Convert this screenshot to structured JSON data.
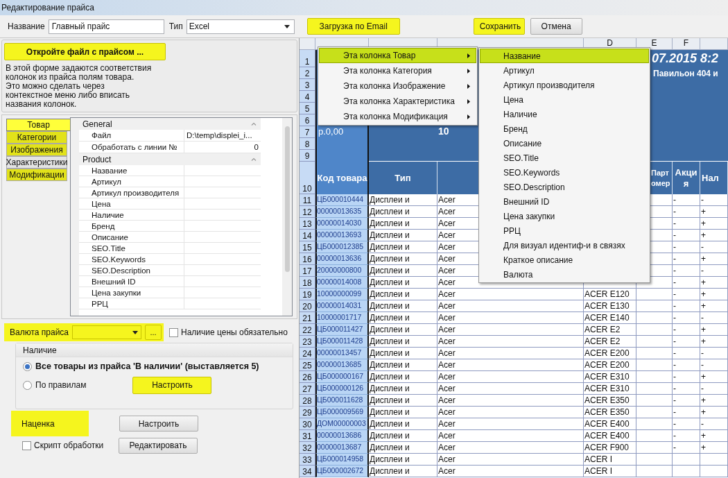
{
  "window": {
    "title": "Редактирование прайса"
  },
  "toolbar": {
    "name_label": "Название",
    "name_value": "Главный прайс",
    "type_label": "Тип",
    "type_value": "Excel",
    "buttons": [
      {
        "label": "Загрузка по Email",
        "highlighted": true
      },
      {
        "label": "Сохранить",
        "highlighted": true
      },
      {
        "label": "Отмена",
        "highlighted": false
      }
    ]
  },
  "open_file_button": {
    "label": "Откройте файл с прайсом ...",
    "highlighted": true
  },
  "description": "В этой форме задаются соответствия\nколонок из прайса полям товара.\nЭто можно сделать через\nконтекстное меню либо вписать\nназвания колонок.",
  "tabs": [
    {
      "label": "Товар",
      "selected": true,
      "highlighted": true
    },
    {
      "label": "Категории",
      "selected": false,
      "highlighted": true
    },
    {
      "label": "Изображения",
      "selected": false,
      "highlighted": true
    },
    {
      "label": "Характеристики",
      "selected": false,
      "highlighted": false
    },
    {
      "label": "Модификации",
      "selected": false,
      "highlighted": true
    }
  ],
  "property_grid": {
    "categories": [
      {
        "name": "General",
        "expanded": true,
        "rows": [
          {
            "label": "Файл",
            "value": "D:\\temp\\displei_i..."
          },
          {
            "label": "Обработать с линии №",
            "value": "0",
            "kind": "number"
          }
        ]
      },
      {
        "name": "Product",
        "expanded": true,
        "rows": [
          {
            "label": "Название"
          },
          {
            "label": "Артикул"
          },
          {
            "label": "Артикул производителя"
          },
          {
            "label": "Цена"
          },
          {
            "label": "Наличие"
          },
          {
            "label": "Бренд"
          },
          {
            "label": "Описание"
          },
          {
            "label": "SEO.Title"
          },
          {
            "label": "SEO.Keywords"
          },
          {
            "label": "SEO.Description"
          },
          {
            "label": "Внешний ID"
          },
          {
            "label": "Цена закупки"
          },
          {
            "label": "РРЦ"
          }
        ]
      }
    ]
  },
  "currency": {
    "label": "Валюта прайса",
    "highlighted": true,
    "more_button": "...",
    "price_required": {
      "label": "Наличие цены обязательно",
      "checked": false
    }
  },
  "availability": {
    "title": "Наличие",
    "options": [
      {
        "label": "Все товары из прайса 'В наличии' (выставляется 5)",
        "selected": true
      },
      {
        "label": "По правилам",
        "selected": false
      }
    ],
    "configure_button": {
      "label": "Настроить",
      "highlighted": true
    }
  },
  "markup": {
    "label": "Наценка",
    "highlighted": true,
    "button": "Настроить"
  },
  "script": {
    "label": "Скрипт обработки",
    "checked": false,
    "button": "Редактировать"
  },
  "sheet": {
    "column_letters": [
      "D",
      "E",
      "F"
    ],
    "row_numbers": [
      "1",
      "2",
      "3",
      "4",
      "5",
      "6",
      "7",
      "8",
      "9",
      "10"
    ],
    "banner": {
      "datetime": "07.2015 8:2",
      "location": "Павильон 404 и",
      "price": "р.0,00",
      "count": "10"
    },
    "header": {
      "a": "Код товара",
      "b": "Тип",
      "e": "Парт омер",
      "f": "Акция",
      "g": "Нал"
    },
    "rows": [
      {
        "n": "11",
        "a": "ЦБ000010444",
        "b": "Дисплеи и",
        "c": "Acer",
        "f": "-",
        "g": "-"
      },
      {
        "n": "12",
        "a": "00000013635",
        "b": "Дисплеи и",
        "c": "Acer",
        "f": "-",
        "g": "+"
      },
      {
        "n": "13",
        "a": "00000014030",
        "b": "Дисплеи и",
        "c": "Acer",
        "f": "-",
        "g": "+"
      },
      {
        "n": "14",
        "a": "00000013693",
        "b": "Дисплеи и",
        "c": "Acer",
        "f": "-",
        "g": "+"
      },
      {
        "n": "15",
        "a": "ЦБ000012385",
        "b": "Дисплеи и",
        "c": "Acer",
        "f": "-",
        "g": "-"
      },
      {
        "n": "16",
        "a": "00000013636",
        "b": "Дисплеи и",
        "c": "Acer",
        "f": "-",
        "g": "+"
      },
      {
        "n": "17",
        "a": "20000000800",
        "b": "Дисплеи и",
        "c": "Acer",
        "f": "-",
        "g": "-"
      },
      {
        "n": "18",
        "a": "00000014008",
        "b": "Дисплеи и",
        "c": "Acer",
        "f": "-",
        "g": "+"
      },
      {
        "n": "19",
        "a": "10000000099",
        "b": "Дисплеи и",
        "c": "Acer",
        "d": "ACER E120",
        "f": "-",
        "g": "+"
      },
      {
        "n": "20",
        "a": "00000014031",
        "b": "Дисплеи и",
        "c": "Acer",
        "d": "ACER E130",
        "f": "-",
        "g": "+"
      },
      {
        "n": "21",
        "a": "10000001717",
        "b": "Дисплеи и",
        "c": "Acer",
        "d": "ACER E140",
        "f": "-",
        "g": "-"
      },
      {
        "n": "22",
        "a": "ЦБ000011427",
        "b": "Дисплеи и",
        "c": "Acer",
        "d": "ACER E2",
        "f": "-",
        "g": "+"
      },
      {
        "n": "23",
        "a": "ЦБ000011428",
        "b": "Дисплеи и",
        "c": "Acer",
        "d": "ACER E2",
        "f": "-",
        "g": "+"
      },
      {
        "n": "24",
        "a": "00000013457",
        "b": "Дисплеи и",
        "c": "Acer",
        "d": "ACER E200",
        "f": "-",
        "g": "-"
      },
      {
        "n": "25",
        "a": "00000013685",
        "b": "Дисплеи и",
        "c": "Acer",
        "d": "ACER E200",
        "f": "-",
        "g": "-"
      },
      {
        "n": "26",
        "a": "ЦБ000000167",
        "b": "Дисплеи и",
        "c": "Acer",
        "d": "ACER E310",
        "f": "-",
        "g": "+"
      },
      {
        "n": "27",
        "a": "ЦБ000000126",
        "b": "Дисплеи и",
        "c": "Acer",
        "d": "ACER E310",
        "f": "-",
        "g": "-"
      },
      {
        "n": "28",
        "a": "ЦБ000011628",
        "b": "Дисплеи и",
        "c": "Acer",
        "d": "ACER E350",
        "f": "-",
        "g": "+"
      },
      {
        "n": "29",
        "a": "ЦБ000009569",
        "b": "Дисплеи и",
        "c": "Acer",
        "d": "ACER E350",
        "f": "-",
        "g": "+"
      },
      {
        "n": "30",
        "a": "ДОМ00000003",
        "b": "Дисплеи и",
        "c": "Acer",
        "d": "ACER E400",
        "f": "-",
        "g": "-"
      },
      {
        "n": "31",
        "a": "00000013686",
        "b": "Дисплеи и",
        "c": "Acer",
        "d": "ACER E400",
        "f": "-",
        "g": "+"
      },
      {
        "n": "32",
        "a": "00000013687",
        "b": "Дисплеи и",
        "c": "Acer",
        "d": "ACER F900",
        "f": "-",
        "g": "+"
      },
      {
        "n": "33",
        "a": "ЦБ000014958",
        "b": "Дисплеи и",
        "c": "Acer",
        "d": "ACER I"
      },
      {
        "n": "34",
        "a": "ЦБ000002672",
        "b": "Дисплеи и",
        "c": "Acer",
        "d": "ACER I"
      }
    ]
  },
  "context_menu": {
    "items": [
      {
        "label": "Эта колонка Товар",
        "selected": true
      },
      {
        "label": "Эта колонка Категория",
        "selected": false
      },
      {
        "label": "Эта колонка Изображение",
        "selected": false
      },
      {
        "label": "Эта колонка Характеристика",
        "selected": false
      },
      {
        "label": "Эта колонка Модификация",
        "selected": false
      }
    ]
  },
  "submenu": {
    "items": [
      {
        "label": "Название",
        "selected": true
      },
      {
        "label": "Артикул",
        "selected": false
      },
      {
        "label": "Артикул производителя",
        "selected": false
      },
      {
        "label": "Цена",
        "selected": false
      },
      {
        "label": "Наличие",
        "selected": false
      },
      {
        "label": "Бренд",
        "selected": false
      },
      {
        "label": "Описание",
        "selected": false
      },
      {
        "label": "SEO.Title",
        "selected": false
      },
      {
        "label": "SEO.Keywords",
        "selected": false
      },
      {
        "label": "SEO.Description",
        "selected": false
      },
      {
        "label": "Внешний ID",
        "selected": false
      },
      {
        "label": "Цена закупки",
        "selected": false
      },
      {
        "label": "РРЦ",
        "selected": false
      },
      {
        "label": "Для визуал идентиф-и в связях",
        "selected": false
      },
      {
        "label": "Краткое описание",
        "selected": false
      },
      {
        "label": "Валюта",
        "selected": false
      }
    ]
  }
}
